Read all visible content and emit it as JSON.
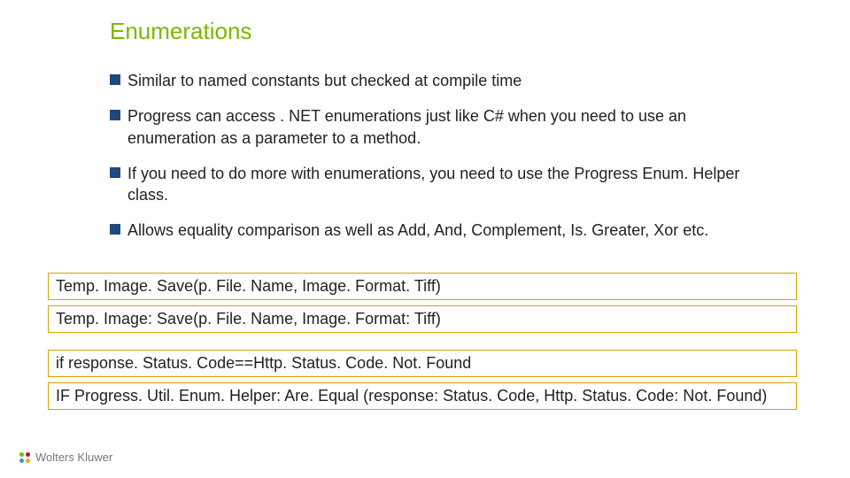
{
  "title": "Enumerations",
  "bullets": [
    "Similar to named constants but checked at compile time",
    "Progress can access . NET enumerations just like C# when you need to use an enumeration as a parameter to a method.",
    "If you need to do more with enumerations, you need to use the Progress Enum. Helper class.",
    "Allows equality comparison as well as Add, And, Complement, Is. Greater, Xor etc."
  ],
  "code_group1": [
    "Temp. Image. Save(p. File. Name, Image. Format. Tiff)",
    "Temp. Image: Save(p. File. Name, Image. Format: Tiff)"
  ],
  "code_group2": [
    "if response. Status. Code==Http. Status. Code. Not. Found",
    "IF Progress. Util. Enum. Helper: Are. Equal (response: Status. Code, Http. Status. Code: Not. Found)"
  ],
  "footer_brand": "Wolters Kluwer"
}
